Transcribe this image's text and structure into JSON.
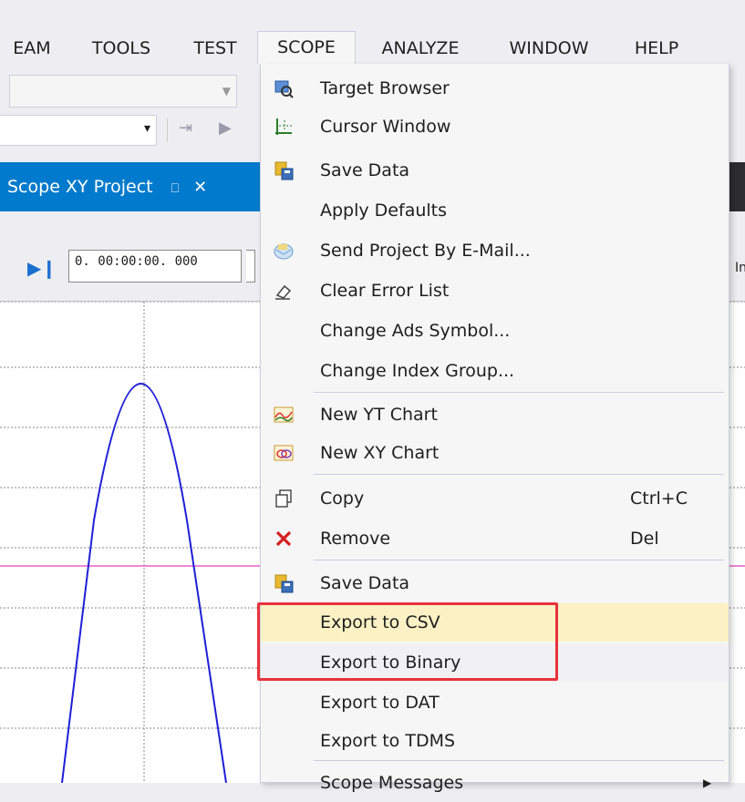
{
  "menubar": {
    "items": [
      "EAM",
      "TOOLS",
      "TEST",
      "SCOPE",
      "ANALYZE",
      "WINDOW",
      "HELP"
    ],
    "active": "SCOPE"
  },
  "tab": {
    "title": "Scope XY Project",
    "pin": "⎕",
    "close": "✕"
  },
  "timebar": {
    "time_value": "0. 00:00:00. 000",
    "right_text": "In"
  },
  "scope_menu": {
    "items": [
      {
        "label": "Target Browser",
        "icon": "target-browser-icon"
      },
      {
        "label": "Cursor Window",
        "icon": "cursor-window-icon"
      },
      {
        "label": "Save Data",
        "icon": "save-data-icon"
      },
      {
        "label": "Apply Defaults",
        "icon": ""
      },
      {
        "label": "Send Project By E-Mail...",
        "icon": "email-icon"
      },
      {
        "label": "Clear Error List",
        "icon": "eraser-icon"
      },
      {
        "label": "Change Ads Symbol...",
        "icon": ""
      },
      {
        "label": "Change Index Group...",
        "icon": ""
      },
      {
        "label": "New YT Chart",
        "icon": "yt-chart-icon"
      },
      {
        "label": "New XY Chart",
        "icon": "xy-chart-icon"
      },
      {
        "label": "Copy",
        "icon": "copy-icon",
        "shortcut": "Ctrl+C"
      },
      {
        "label": "Remove",
        "icon": "remove-icon",
        "shortcut": "Del"
      },
      {
        "label": "Save Data",
        "icon": "save-data-icon"
      },
      {
        "label": "Export to CSV",
        "icon": ""
      },
      {
        "label": "Export to Binary",
        "icon": ""
      },
      {
        "label": "Export to DAT",
        "icon": ""
      },
      {
        "label": "Export to TDMS",
        "icon": ""
      },
      {
        "label": "Scope Messages",
        "icon": "",
        "submenu": true
      }
    ],
    "highlighted": "Export to CSV"
  },
  "colors": {
    "accent": "#007acc",
    "highlight_box": "#e8323c",
    "curve": "#1f1fd6",
    "marker_line": "#e040c0"
  }
}
